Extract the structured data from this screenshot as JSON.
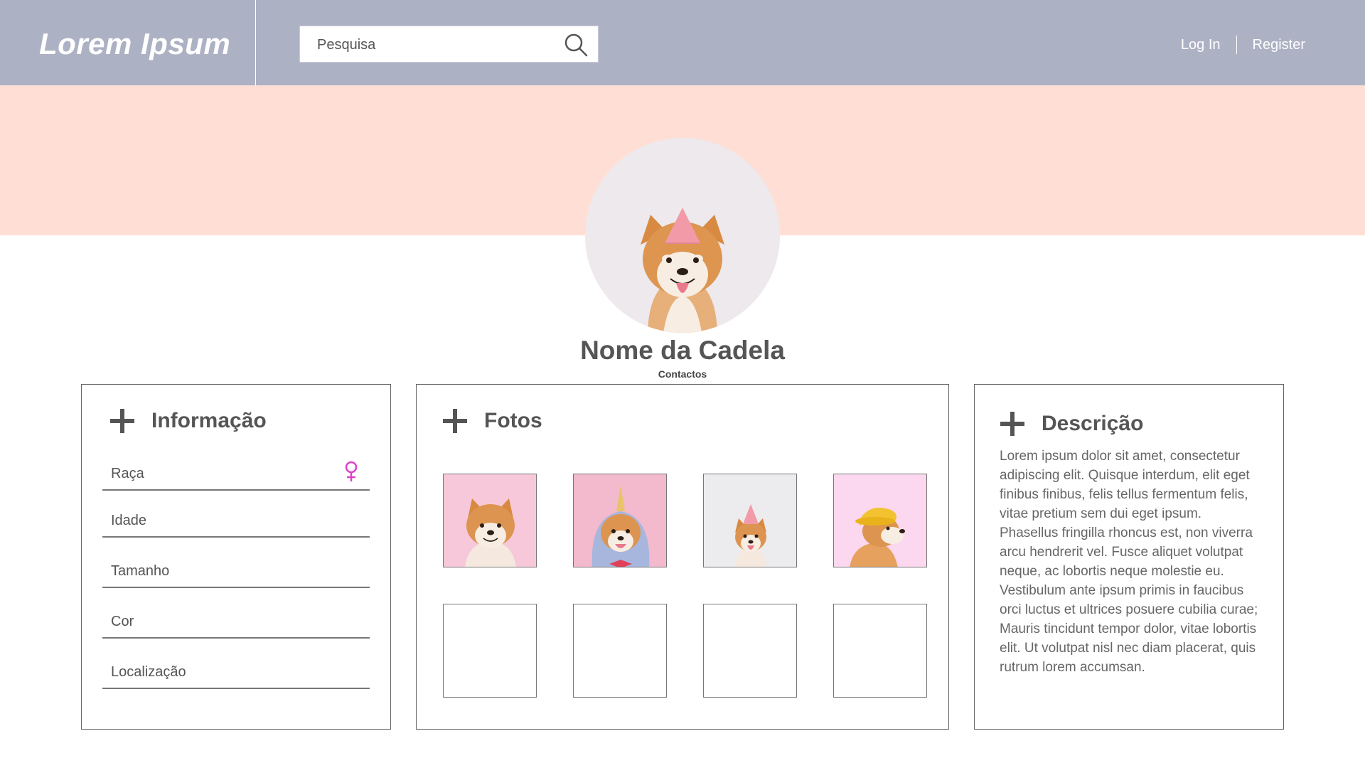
{
  "header": {
    "logo": "Lorem Ipsum",
    "search_placeholder": "Pesquisa",
    "login": "Log In",
    "register": "Register"
  },
  "profile": {
    "name": "Nome da Cadela",
    "contacts": "Contactos"
  },
  "info": {
    "title": "Informação",
    "fields": [
      "Raça",
      "Idade",
      "Tamanho",
      "Cor",
      "Localização"
    ]
  },
  "photos": {
    "title": "Fotos",
    "filled": [
      {
        "bg": "#f6c8d9",
        "accessory": "none"
      },
      {
        "bg": "#f3b9cc",
        "accessory": "unicorn-hood"
      },
      {
        "bg": "#ecebed",
        "accessory": "party-hat"
      },
      {
        "bg": "#fbd8ef",
        "accessory": "yellow-hat"
      }
    ],
    "empty_slots": 4
  },
  "description": {
    "title": "Descrição",
    "text": "Lorem ipsum dolor sit amet, consectetur adipiscing elit. Quisque interdum, elit eget finibus finibus, felis tellus fermentum felis, vitae pretium sem dui eget ipsum. Phasellus fringilla rhoncus est, non viverra arcu hendrerit vel. Fusce aliquet volutpat neque, ac lobortis neque molestie eu. Vestibulum ante ipsum primis in faucibus orci luctus et ultrices posuere cubilia curae; Mauris tincidunt tempor dolor, vitae lobortis elit. Ut volutpat nisl nec diam placerat, quis rutrum lorem accumsan."
  },
  "colors": {
    "header": "#adb1c4",
    "banner": "#ffdfd5",
    "female_icon": "#e040c8"
  }
}
